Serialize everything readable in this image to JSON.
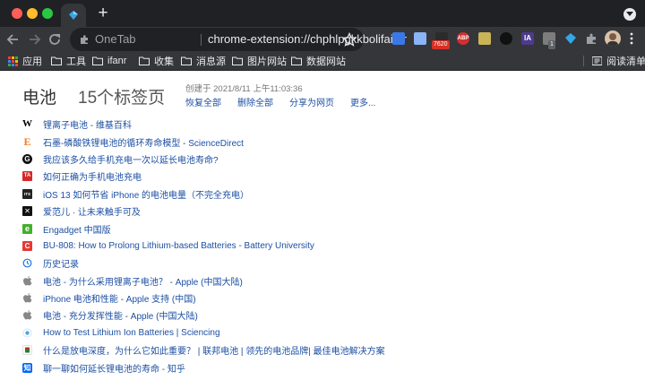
{
  "omnibox": {
    "site_name": "OneTab",
    "url": "chrome-extension://chphlpgkkbolifaimnlloi..."
  },
  "extensions": {
    "badge_count": "7620",
    "abp_label": "ABP",
    "ia_label": "IA",
    "notif_count": "1"
  },
  "bookmarks": {
    "items": [
      {
        "label": "应用"
      },
      {
        "label": "工具"
      },
      {
        "label": "ifanr"
      },
      {
        "label": "收集"
      },
      {
        "label": "消息源"
      },
      {
        "label": "图片网站"
      },
      {
        "label": "数据网站"
      }
    ],
    "reading_list": "阅读清单"
  },
  "group": {
    "title": "电池",
    "count": "15个标签页",
    "created": "创建于 2021/8/11 上午11:03:36",
    "actions": [
      "恢复全部",
      "删除全部",
      "分享为网页",
      "更多..."
    ]
  },
  "tabs": [
    {
      "title": "锂离子电池 - 维基百科",
      "icon": "wikipedia-icon",
      "glyph": "W"
    },
    {
      "title": "石墨-磷酸铁锂电池的循环寿命模型 - ScienceDirect",
      "icon": "elsevier-icon",
      "glyph": "E"
    },
    {
      "title": "我应该多久给手机充电一次以延长电池寿命?",
      "icon": "google-icon",
      "glyph": "G"
    },
    {
      "title": "如何正确为手机电池充电",
      "icon": "ta-icon",
      "glyph": "TA"
    },
    {
      "title": "iOS 13 如何节省 iPhone 的电池电量（不完全充电）",
      "icon": "news-icon",
      "glyph": "ITS"
    },
    {
      "title": "爱范儿 · 让未来触手可及",
      "icon": "ifanr-icon",
      "glyph": "✕"
    },
    {
      "title": "Engadget 中国版",
      "icon": "engadget-icon",
      "glyph": "e"
    },
    {
      "title": "BU-808: How to Prolong Lithium-based Batteries - Battery University",
      "icon": "battery-university-icon",
      "glyph": "C"
    },
    {
      "title": "历史记录",
      "icon": "history-icon",
      "glyph": ""
    },
    {
      "title": "电池 - 为什么采用锂离子电池？ - Apple (中国大陆)",
      "icon": "apple-icon",
      "glyph": ""
    },
    {
      "title": "iPhone 电池和性能 - Apple 支持 (中国)",
      "icon": "apple-icon",
      "glyph": ""
    },
    {
      "title": "电池 - 充分发挥性能 - Apple (中国大陆)",
      "icon": "apple-icon",
      "glyph": ""
    },
    {
      "title": "How to Test Lithium Ion Batteries | Sciencing",
      "icon": "sciencing-icon",
      "glyph": ""
    },
    {
      "title": "什么是放电深度，为什么它如此重要？ | 联邦电池 | 领先的电池品牌| 最佳电池解决方案",
      "icon": "battery-brand-icon",
      "glyph": ""
    },
    {
      "title": "聊一聊如何延长锂电池的寿命 - 知乎",
      "icon": "zhihu-icon",
      "glyph": "知"
    }
  ]
}
